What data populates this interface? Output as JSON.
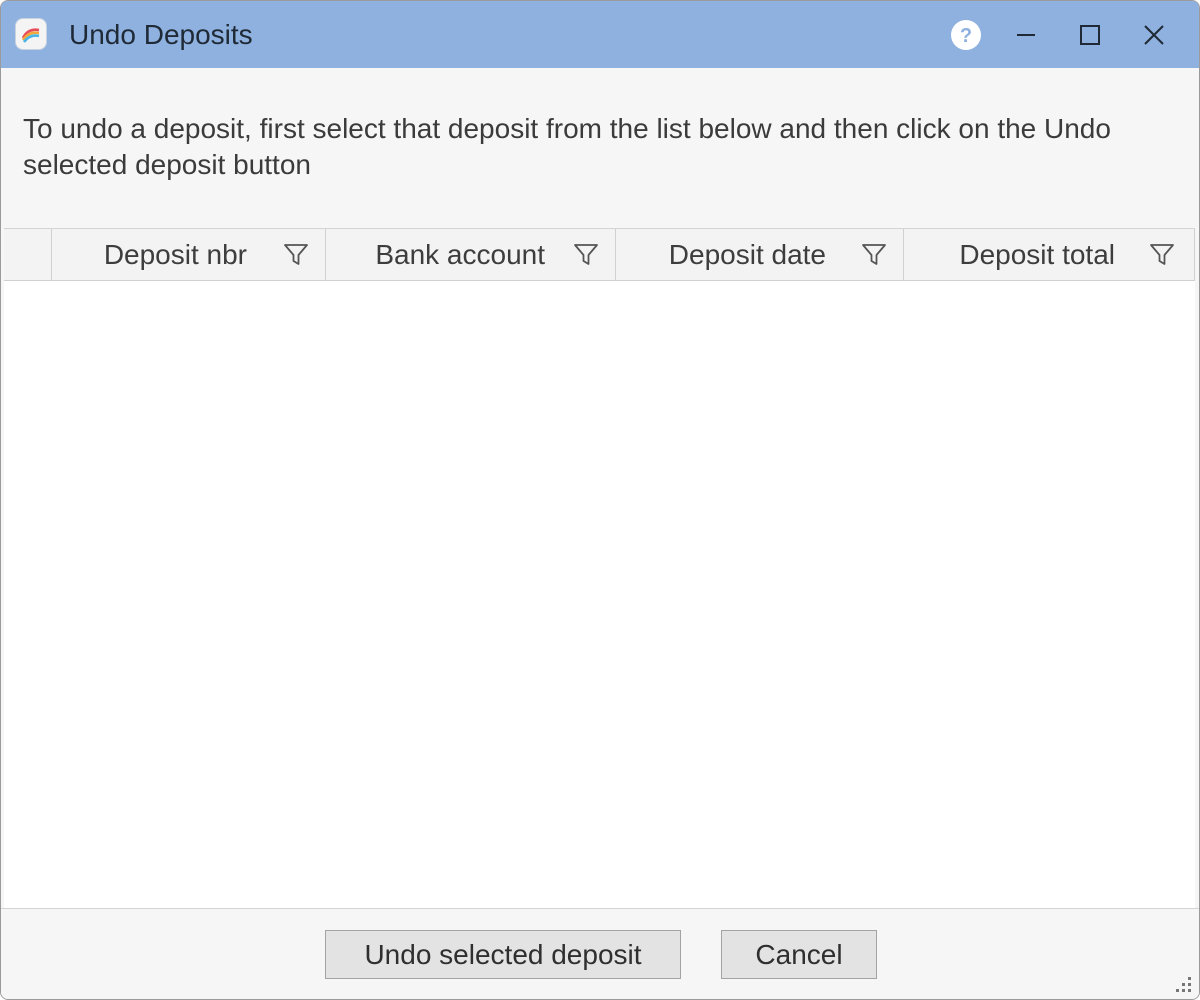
{
  "window": {
    "title": "Undo Deposits",
    "titlebar_color": "#8eb1df",
    "icons": {
      "app": "app-logo-icon",
      "help": "help-icon",
      "minimize": "minimize-icon",
      "maximize": "maximize-icon",
      "close": "close-icon"
    }
  },
  "instructions": "To undo a deposit, first select that deposit from the list below and then click on the Undo selected deposit button",
  "grid": {
    "columns": [
      {
        "label": "Deposit nbr",
        "icon": "filter-icon"
      },
      {
        "label": "Bank account",
        "icon": "filter-icon"
      },
      {
        "label": "Deposit date",
        "icon": "filter-icon"
      },
      {
        "label": "Deposit total",
        "icon": "filter-icon"
      }
    ],
    "rows": []
  },
  "footer": {
    "undo_label": "Undo selected deposit",
    "cancel_label": "Cancel"
  }
}
